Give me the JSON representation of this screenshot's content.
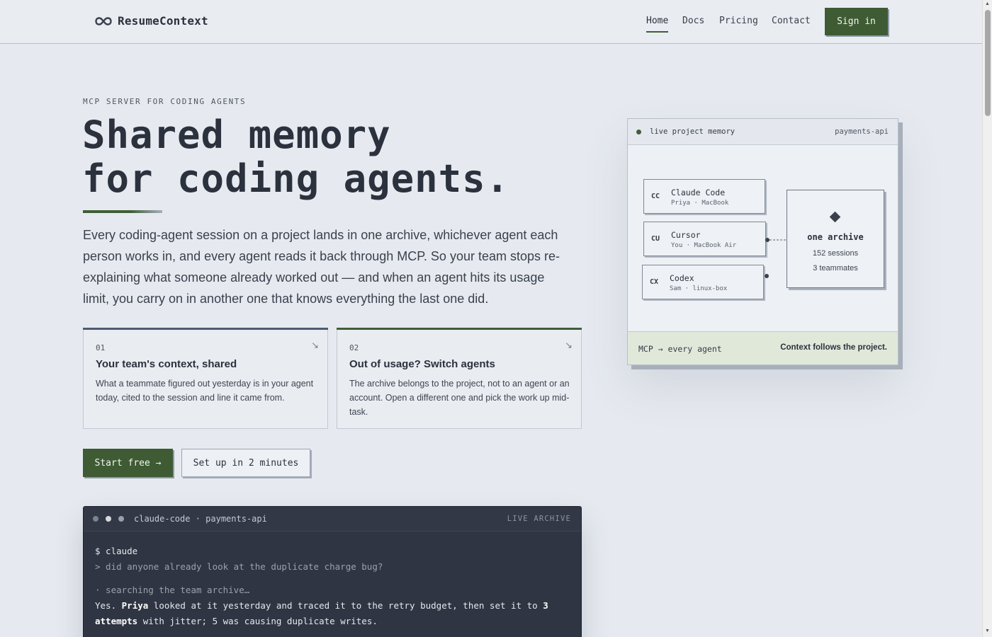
{
  "header": {
    "brand": "ResumeContext",
    "nav": [
      {
        "label": "Home",
        "active": true
      },
      {
        "label": "Docs",
        "active": false
      },
      {
        "label": "Pricing",
        "active": false
      },
      {
        "label": "Contact",
        "active": false
      }
    ],
    "signin_label": "Sign in"
  },
  "hero": {
    "eyebrow": "MCP SERVER FOR CODING AGENTS",
    "headline_line1": "Shared memory",
    "headline_line2": "for coding agents.",
    "lede": "Every coding-agent session on a project lands in one archive, whichever agent each person works in, and every agent reads it back through MCP. So your team stops re-explaining what someone already worked out — and when an agent hits its usage limit, you carry on in another one that knows everything the last one did."
  },
  "cards": [
    {
      "num": "01",
      "title": "Your team's context, shared",
      "desc": "What a teammate figured out yesterday is in your agent today, cited to the session and line it came from.",
      "accent": "#4d5a73"
    },
    {
      "num": "02",
      "title": "Out of usage? Switch agents",
      "desc": "The archive belongs to the project, not to an agent or an account. Open a different one and pick the work up mid-task.",
      "accent": "#3f5e36"
    }
  ],
  "cta": {
    "primary": "Start free →",
    "secondary": "Set up in 2 minutes"
  },
  "terminal": {
    "title": "claude-code · payments-api",
    "badge": "LIVE ARCHIVE",
    "cmd": "$ claude",
    "prompt": "> did anyone already look at the duplicate charge bug?",
    "status": "· searching the team archive…",
    "answer_a": "Yes. ",
    "answer_name": "Priya",
    "answer_b": " looked at it yesterday and traced it to the retry budget, then set it to ",
    "answer_bold": "3",
    "answer_line2_bold": "attempts",
    "answer_line2": " with jitter; 5 was causing duplicate writes."
  },
  "panel": {
    "label": "live project memory",
    "project": "payments-api",
    "agents": [
      {
        "code": "CC",
        "name": "Claude Code",
        "meta": "Priya · MacBook"
      },
      {
        "code": "CU",
        "name": "Cursor",
        "meta": "You · MacBook Air"
      },
      {
        "code": "CX",
        "name": "Codex",
        "meta": "Sam · linux-box"
      }
    ],
    "archive_title": "one archive",
    "archive_sessions": "152 sessions",
    "archive_teammates": "3 teammates",
    "foot_left": "MCP → every agent",
    "foot_right": "Context follows the project."
  },
  "colors": {
    "accent_green": "#3e5b34",
    "ink": "#2b313d",
    "background": "#e6eaf0",
    "terminal_bg": "#2f3542"
  }
}
